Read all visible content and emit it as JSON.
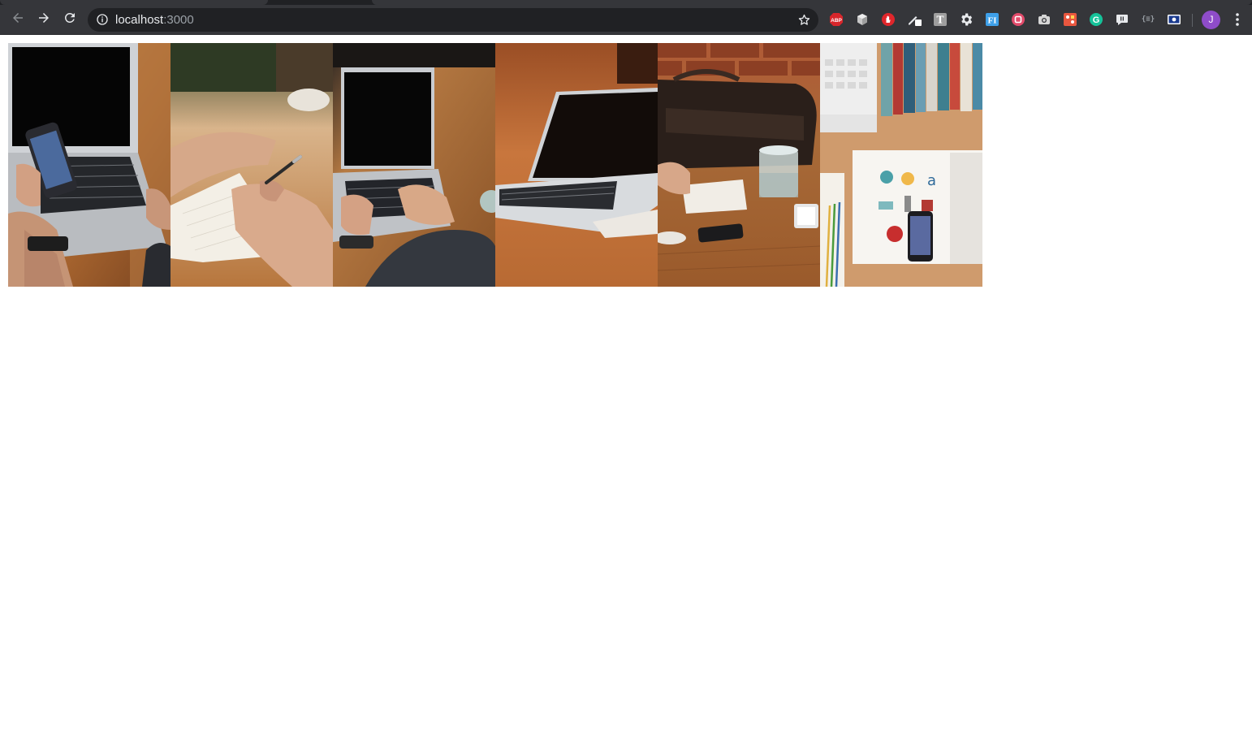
{
  "browser": {
    "url_host": "localhost",
    "url_port": ":3000",
    "avatar_initial": "J",
    "icons": {
      "back": "arrow-left-icon",
      "forward": "arrow-right-icon",
      "reload": "reload-icon",
      "site_info": "info-icon",
      "bookmark": "star-icon",
      "menu": "three-dots-vertical-icon"
    },
    "extensions": [
      {
        "name": "adblock-plus-icon",
        "label": "ABP",
        "color": "#d8262b"
      },
      {
        "name": "cube-extension-icon",
        "label": "",
        "color": "#c7c7c7"
      },
      {
        "name": "hand-stop-extension-icon",
        "label": "",
        "color": "#e0262b"
      },
      {
        "name": "pen-extension-icon",
        "label": "",
        "color": "#e8eaed"
      },
      {
        "name": "t-extension-icon",
        "label": "T",
        "color": "#9e9e9e"
      },
      {
        "name": "gear-extension-icon",
        "label": "",
        "color": "#e8eaed"
      },
      {
        "name": "fi-extension-icon",
        "label": "FI",
        "color": "#3ea0e9"
      },
      {
        "name": "square-extension-icon",
        "label": "",
        "color": "#e24b6b"
      },
      {
        "name": "camera-extension-icon",
        "label": "",
        "color": "#d6d6d6"
      },
      {
        "name": "puzzle-extension-icon",
        "label": "",
        "color": "#e9573f"
      },
      {
        "name": "grammarly-icon",
        "label": "G",
        "color": "#15c39a"
      },
      {
        "name": "chat-extension-icon",
        "label": "",
        "color": "#e8eaed"
      },
      {
        "name": "json-extension-icon",
        "label": "{≡}",
        "color": "#9aa0a6"
      },
      {
        "name": "card-extension-icon",
        "label": "",
        "color": "#ffffff"
      }
    ]
  },
  "gallery": {
    "photos": [
      {
        "name": "photo-laptop-phone",
        "scene": "hand holding smartphone in front of laptop on wooden table"
      },
      {
        "name": "photo-writing-notebook",
        "scene": "hand writing with pen in notebook"
      },
      {
        "name": "photo-typing-laptop",
        "scene": "hands typing on laptop keyboard"
      },
      {
        "name": "photo-laptop-side",
        "scene": "laptop on wooden table, warm light"
      },
      {
        "name": "photo-desk-bag-glass",
        "scene": "bag, glass of water, phone and notebook on desk"
      },
      {
        "name": "photo-flatlay-books",
        "scene": "flatlay with laptop, books, magazine and phone"
      }
    ]
  }
}
